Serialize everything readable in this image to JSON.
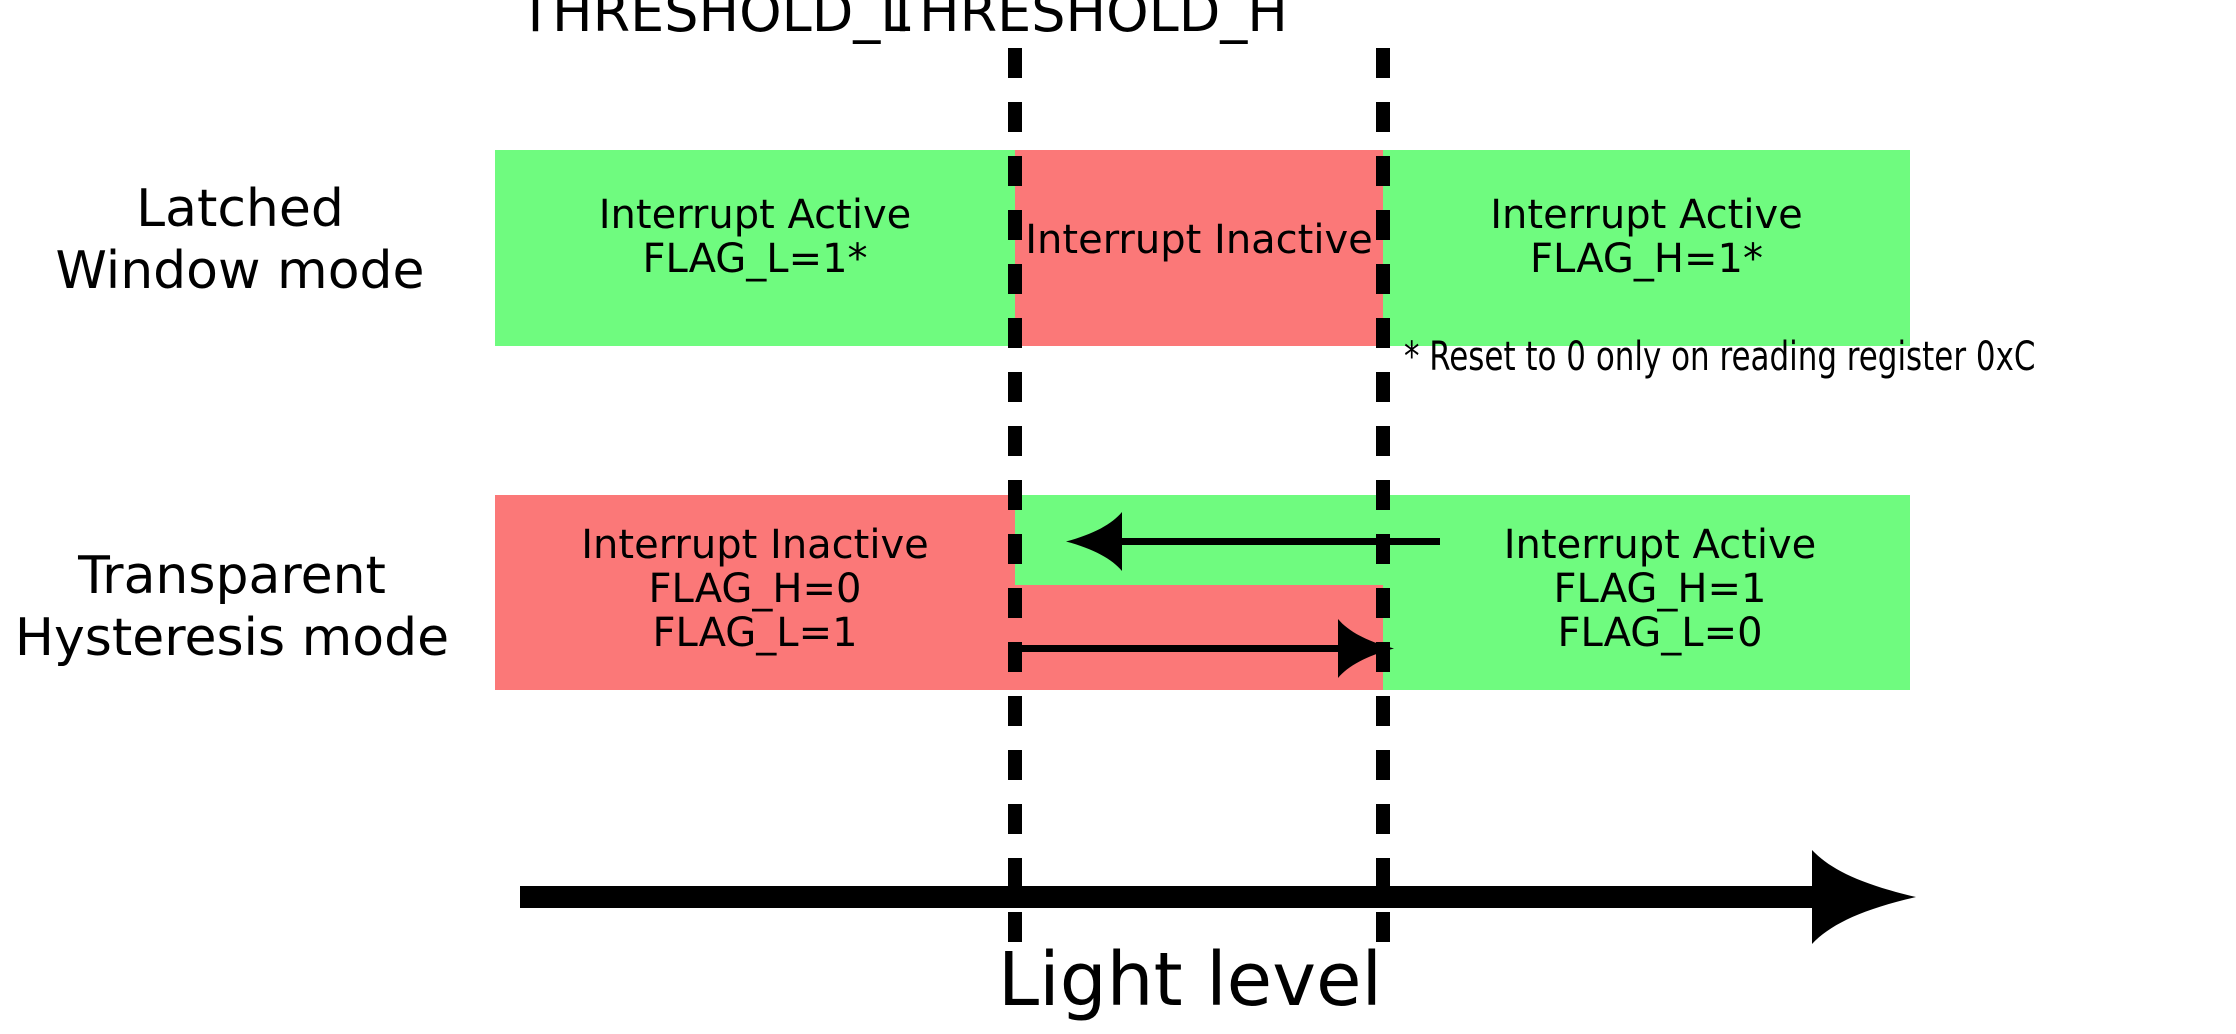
{
  "diagram": {
    "title_visible": false,
    "colors": {
      "active_green": "#6FFB7F",
      "inactive_red": "#FB7878",
      "line_black": "#000000",
      "background": "#FFFFFF"
    },
    "thresholds": [
      {
        "id": "threshold_low",
        "label": "THRESHOLD_L"
      },
      {
        "id": "threshold_high",
        "label": "THRESHOLD_H"
      }
    ],
    "rows": [
      {
        "id": "latched-window-mode",
        "mode_label_lines": [
          "Latched",
          "Window mode"
        ],
        "segments": [
          {
            "id": "latched-below-low",
            "state": "active",
            "color": "#6FFB7F",
            "lines": [
              "Interrupt Active",
              "FLAG_L=1*"
            ]
          },
          {
            "id": "latched-between",
            "state": "inactive",
            "color": "#FB7878",
            "lines": [
              "Interrupt Inactive"
            ]
          },
          {
            "id": "latched-above-high",
            "state": "active",
            "color": "#6FFB7F",
            "lines": [
              "Interrupt Active",
              "FLAG_H=1*"
            ]
          }
        ]
      },
      {
        "id": "transparent-hysteresis-mode",
        "mode_label_lines": [
          "Transparent",
          "Hysteresis mode"
        ],
        "segments": [
          {
            "id": "hyst-below-low",
            "state": "inactive",
            "color": "#FB7878",
            "lines": [
              "Interrupt Inactive",
              "FLAG_H=0",
              "FLAG_L=1"
            ]
          },
          {
            "id": "hyst-above-high",
            "state": "active",
            "color": "#6FFB7F",
            "lines": [
              "Interrupt Active",
              "FLAG_H=1",
              "FLAG_L=0"
            ]
          }
        ],
        "hysteresis_arrows": [
          {
            "id": "falling-light-arrow",
            "direction": "left",
            "meaning": "decreasing light level"
          },
          {
            "id": "rising-light-arrow",
            "direction": "right",
            "meaning": "increasing light level"
          }
        ]
      }
    ],
    "footnote": "* Reset to 0 only on reading register 0xC",
    "axis": {
      "caption": "Light level",
      "direction": "right"
    }
  }
}
